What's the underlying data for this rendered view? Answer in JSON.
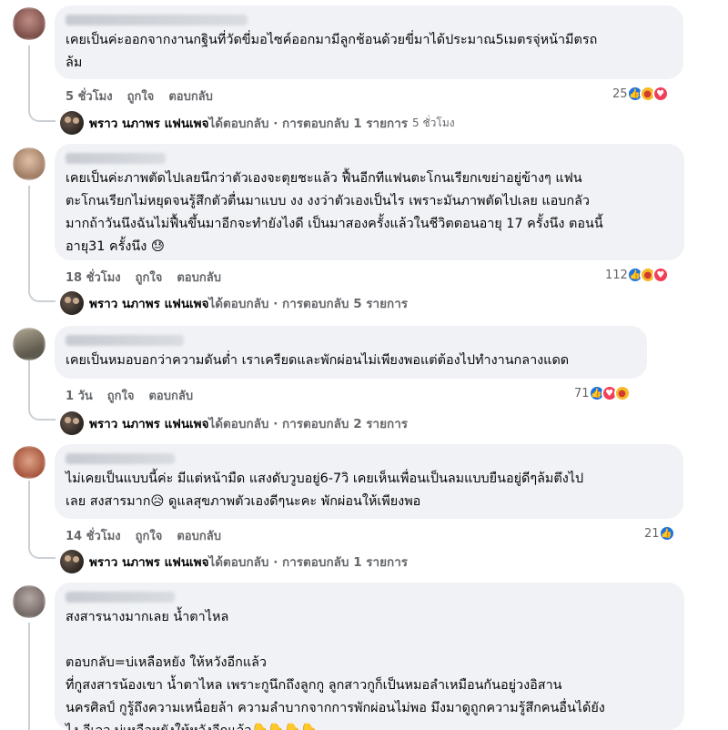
{
  "comments": [
    {
      "text": "เคยเป็นค่ะออกจากงานกฐินที่วัดขี่มอไซค์ออกมามีลูกช้อนด้วยขี่มาได้ประมาณ5เมตรจุ่หน้ามีตรถ\nล้ม",
      "time": "5 ชั่วโมง",
      "like_label": "ถูกใจ",
      "reply_label": "ตอบกลับ",
      "reaction_count": "25",
      "reactions": [
        "like",
        "care",
        "love"
      ],
      "reply": {
        "name": "พราว นภาพร แฟนเพจ",
        "rest": " ได้ตอบกลับ · การตอบกลับ 1 รายการ",
        "time": "5 ชั่วโมง"
      }
    },
    {
      "text": "เคยเป็นค่ะภาพตัดไปเลยนึกว่าตัวเองจะตุยชะแล้ว ฟื้นอีกทีแฟนตะโกนเรียกเขย่าอยู่ข้างๆ แฟน\nตะโกนเรียกไม่หยุดจนรู้สึกตัวตื่นมาแบบ งง งงว่าตัวเองเป็นไร เพราะมันภาพตัดไปเลย แอบกลัว\nมากถ้าวันนึงฉันไม่ฟื้นขึ้นมาอีกจะทำยังไงดี เป็นมาสองครั้งแล้วในชีวิตตอนอายุ 17 ครั้งนึง ตอนนี้\nอายุ31 ครั้งนึง 😓",
      "time": "18 ชั่วโมง",
      "like_label": "ถูกใจ",
      "reply_label": "ตอบกลับ",
      "reaction_count": "112",
      "reactions": [
        "like",
        "care",
        "love"
      ],
      "reply": {
        "name": "พราว นภาพร แฟนเพจ",
        "rest": " ได้ตอบกลับ · การตอบกลับ 5 รายการ",
        "time": ""
      }
    },
    {
      "text": "เคยเป็นหมอบอกว่าความดันต่ำ เราเครียดและพักผ่อนไม่เพียงพอแต่ต้องไปทำงานกลางแดด",
      "time": "1 วัน",
      "like_label": "ถูกใจ",
      "reply_label": "ตอบกลับ",
      "reaction_count": "71",
      "reactions": [
        "like",
        "love",
        "care"
      ],
      "reply": {
        "name": "พราว นภาพร แฟนเพจ",
        "rest": " ได้ตอบกลับ · การตอบกลับ 2 รายการ",
        "time": ""
      }
    },
    {
      "text": "ไม่เคยเป็นแบบนี้ค่ะ มีแต่หน้ามืด แสงดับวูบอยู่6-7วิ เคยเห็นเพื่อนเป็นลมแบบยืนอยู่ดีๆล้มตึงไป\nเลย สงสารมาก😥 ดูแลสุขภาพตัวเองดีๆนะคะ พักผ่อนให้เพียงพอ",
      "time": "14 ชั่วโมง",
      "like_label": "ถูกใจ",
      "reply_label": "ตอบกลับ",
      "reaction_count": "21",
      "reactions": [
        "like"
      ],
      "reply": {
        "name": "พราว นภาพร แฟนเพจ",
        "rest": " ได้ตอบกลับ · การตอบกลับ 1 รายการ",
        "time": ""
      }
    },
    {
      "text": "สงสารนางมากเลย น้ำตาไหล\n\nตอบกลับ=บ่เหลือหยัง ให้หวังอีกแล้ว\nที่กูสงสารน้องเขา น้ำตาไหล เพราะกูนึกถึงลูกกู ลูกสาวกูก็เป็นหมอลำเหมือนกันอยู่วงอิสาน\nนครศิลป์ กูรู้ถึงความเหนื่อยล้า ความลำบากจากการพักผ่อนไม่พอ มึงมาดูถูกความรู้สึกคนอื่นได้ยัง\nไง อีเลว บ่เหลือหยังให้หวังอีกแล้ว👇👇👇👇"
    }
  ],
  "colors": {
    "bubble": "#f0f2f5",
    "meta": "#65676b",
    "like": "#1b74e4",
    "love": "#f33e58",
    "care": "#f7b928"
  }
}
